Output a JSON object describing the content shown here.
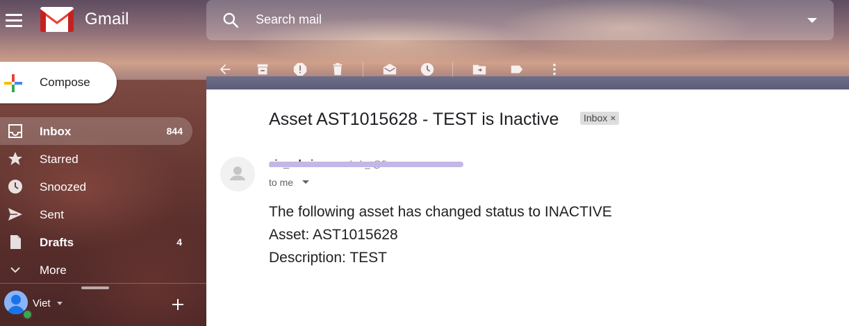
{
  "app": {
    "name": "Gmail"
  },
  "search": {
    "placeholder": "Search mail"
  },
  "toolbar": {
    "icons": [
      "back-arrow-icon",
      "archive-icon",
      "report-spam-icon",
      "delete-icon",
      "mark-unread-icon",
      "snooze-icon",
      "move-to-icon",
      "label-icon",
      "more-vert-icon"
    ]
  },
  "compose": {
    "label": "Compose"
  },
  "sidebar": {
    "items": [
      {
        "label": "Inbox",
        "count": "844",
        "icon": "inbox-icon"
      },
      {
        "label": "Starred",
        "count": "",
        "icon": "star-icon"
      },
      {
        "label": "Snoozed",
        "count": "",
        "icon": "clock-icon"
      },
      {
        "label": "Sent",
        "count": "",
        "icon": "send-icon"
      },
      {
        "label": "Drafts",
        "count": "4",
        "icon": "draft-icon"
      },
      {
        "label": "More",
        "count": "",
        "icon": "chevron-down-icon"
      }
    ]
  },
  "user": {
    "name": "Viet"
  },
  "email": {
    "subject": "Asset AST1015628 - TEST is Inactive",
    "label": "Inbox",
    "label_close": "×",
    "sender_name": "sis_admin",
    "sender_email": "<ssheb_t@fl>",
    "recipient": "to me",
    "body": [
      "The following asset has changed status to INACTIVE",
      "Asset: AST1015628",
      "Description: TEST"
    ]
  },
  "colors": {
    "accent_red": "#EA4335",
    "accent_blue": "#4285F4",
    "accent_yellow": "#FBBC04",
    "accent_green": "#34A853",
    "redaction": "#c3b7e6"
  }
}
